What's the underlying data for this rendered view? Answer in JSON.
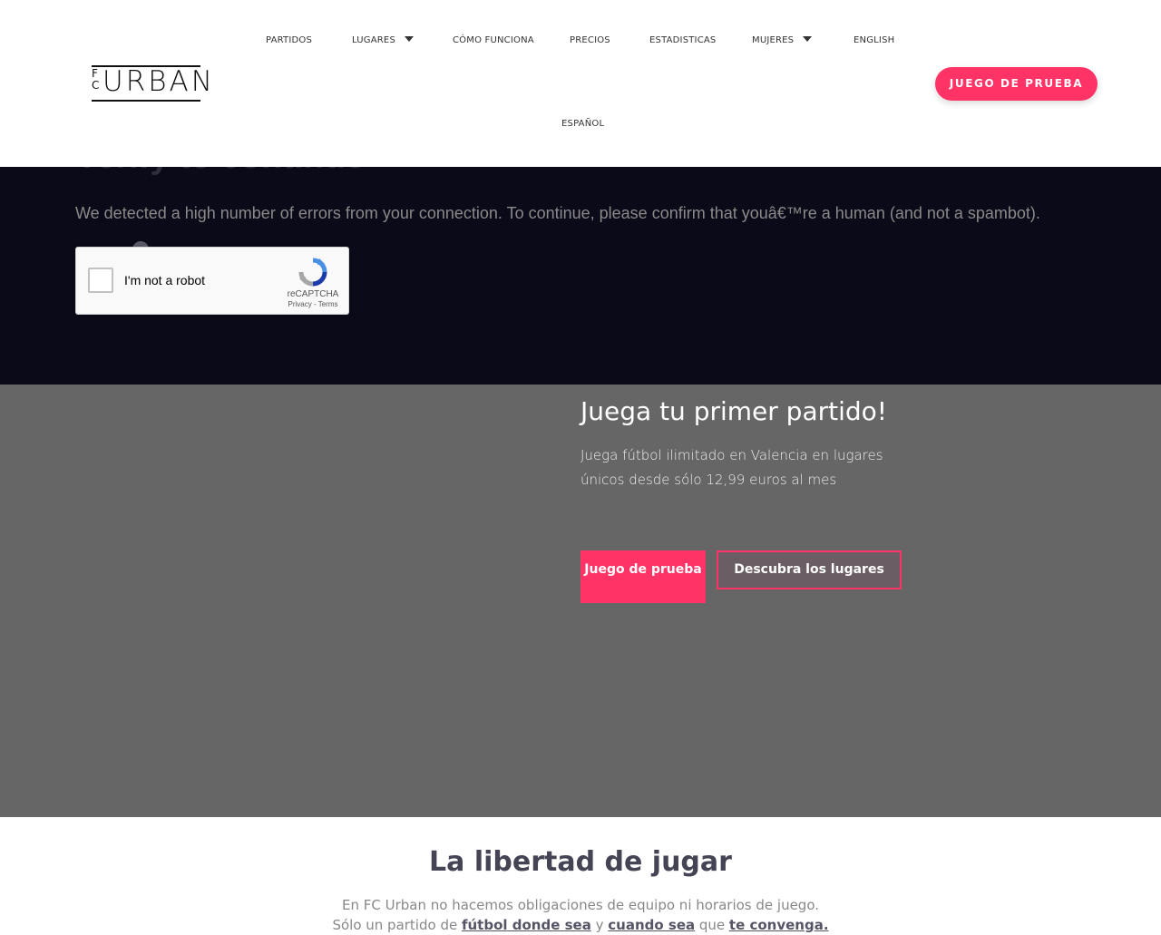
{
  "header": {
    "logo": {
      "fc_top": "F",
      "fc_bottom": "C",
      "word": "URBAN"
    },
    "nav": [
      {
        "label": "PARTIDOS"
      },
      {
        "label": "LUGARES"
      },
      {
        "label": "CÓMO FUNCIONA"
      },
      {
        "label": "PRECIOS"
      },
      {
        "label": "ESTADISTICAS"
      },
      {
        "label": "MUJERES"
      },
      {
        "label": "ENGLISH"
      },
      {
        "label": "ESPAÑOL"
      }
    ],
    "cta_label": "JUEGO DE PRUEBA"
  },
  "verify": {
    "title": "Verify to continue",
    "message": "We detected a high number of errors from your connection. To continue, please confirm that youâ€™re a human (and not a spambot).",
    "recaptcha": {
      "label": "I'm not a robot",
      "brand": "reCAPTCHA",
      "privacy": "Privacy",
      "sep": " - ",
      "terms": "Terms"
    }
  },
  "hero": {
    "title": "Juega tu primer partido!",
    "text": "Juega fútbol ilimitado en Valencia en lugares únicos desde sólo 12,99 euros al mes",
    "primary_button": "Juego de prueba",
    "secondary_button": "Descubra los lugares"
  },
  "freedom": {
    "title": "La libertad de jugar",
    "line1": "En FC Urban no hacemos obligaciones de equipo ni horarios de juego.",
    "line2_a": "Sólo un partido de ",
    "line2_b": "fútbol donde sea",
    "line2_c": " y ",
    "line2_d": "cuando sea",
    "line2_e": " que ",
    "line2_f": "te convenga."
  },
  "colors": {
    "accent": "#ff3366",
    "verify_bg": "#0b0a18",
    "hero_bg": "#666666"
  }
}
